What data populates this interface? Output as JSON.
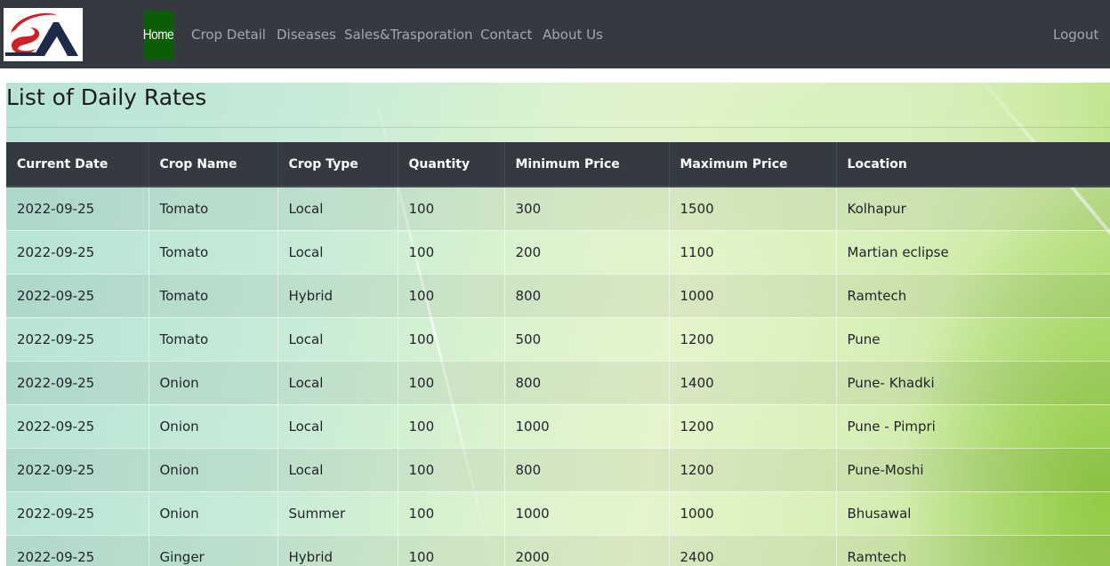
{
  "navbar": {
    "brand_logo": "SA",
    "items": [
      {
        "label": "Home",
        "active": true
      },
      {
        "label": "Crop Detail"
      },
      {
        "label": "Diseases"
      },
      {
        "label": "Sales&Trasporation"
      },
      {
        "label": "Contact"
      },
      {
        "label": "About Us"
      }
    ],
    "logout_label": "Logout"
  },
  "page": {
    "title": "List of Daily Rates"
  },
  "table": {
    "columns": [
      "Current Date",
      "Crop Name",
      "Crop Type",
      "Quantity",
      "Minimum Price",
      "Maximum Price",
      "Location"
    ],
    "rows": [
      [
        "2022-09-25",
        "Tomato",
        "Local",
        "100",
        "300",
        "1500",
        "Kolhapur"
      ],
      [
        "2022-09-25",
        "Tomato",
        "Local",
        "100",
        "200",
        "1100",
        "Martian eclipse"
      ],
      [
        "2022-09-25",
        "Tomato",
        "Hybrid",
        "100",
        "800",
        "1000",
        "Ramtech"
      ],
      [
        "2022-09-25",
        "Tomato",
        "Local",
        "100",
        "500",
        "1200",
        "Pune"
      ],
      [
        "2022-09-25",
        "Onion",
        "Local",
        "100",
        "800",
        "1400",
        "Pune- Khadki"
      ],
      [
        "2022-09-25",
        "Onion",
        "Local",
        "100",
        "1000",
        "1200",
        "Pune - Pimpri"
      ],
      [
        "2022-09-25",
        "Onion",
        "Local",
        "100",
        "800",
        "1200",
        "Pune-Moshi"
      ],
      [
        "2022-09-25",
        "Onion",
        "Summer",
        "100",
        "1000",
        "1000",
        "Bhusawal"
      ],
      [
        "2022-09-25",
        "Ginger",
        "Hybrid",
        "100",
        "2000",
        "2400",
        "Ramtech"
      ]
    ]
  },
  "colors": {
    "navbar_bg": "#343a40",
    "home_active_bg": "#0c5d05",
    "logo_red": "#d11f26",
    "logo_navy": "#1d2a4a"
  }
}
